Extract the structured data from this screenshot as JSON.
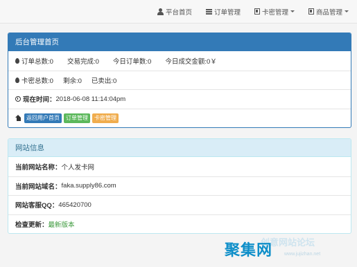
{
  "nav": [
    {
      "label": "平台首页",
      "icon": "user-icon",
      "dropdown": false
    },
    {
      "label": "订单管理",
      "icon": "list-icon",
      "dropdown": false
    },
    {
      "label": "卡密管理",
      "icon": "card-icon",
      "dropdown": true
    },
    {
      "label": "商品管理",
      "icon": "card-icon",
      "dropdown": true
    }
  ],
  "admin": {
    "title": "后台管理首页",
    "orders_total": "订单总数:0",
    "trades_done": "交易完成:0",
    "today_orders": "今日订单数:0",
    "today_amount": "今日成交金额:0￥",
    "cards_total": "卡密总数:0",
    "remaining": "剩余:0",
    "sold": "已卖出:0",
    "now_label": "现在时间：",
    "now_value": "2018-06-08 11:14:04pm",
    "buttons": {
      "home": "返回用户首页",
      "orders": "订单管理",
      "cards": "卡密管理"
    }
  },
  "site": {
    "title": "网站信息",
    "name_label": "当前网站名称：",
    "name_value": "个人发卡网",
    "domain_label": "当前网站域名：",
    "domain_value": "faka.supply86.com",
    "qq_label": "网站客服QQ：",
    "qq_value": "465420700",
    "update_label": "检查更新：",
    "update_value": "最新版本"
  },
  "watermark": {
    "big": "聚集网",
    "small": "创意网站论坛",
    "url": "www.jujizhan.net"
  },
  "colors": {
    "primary": "#337ab7",
    "success": "#5cb85c",
    "warning": "#f0ad4e",
    "info_bg": "#d9edf7"
  }
}
